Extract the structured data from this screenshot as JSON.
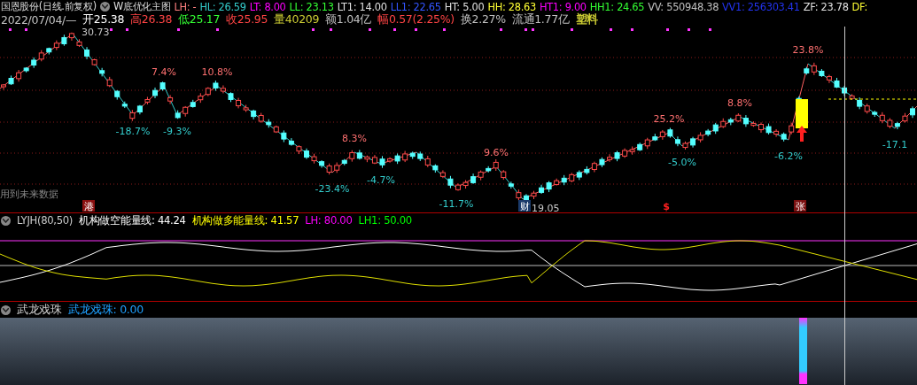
{
  "header": {
    "title": "国恩股份(日线.前复权)",
    "indicator": "W底优化主图",
    "items": [
      {
        "label": "LH: -",
        "color": "#ff8080"
      },
      {
        "label": "HL: 26.59",
        "color": "#33cccc"
      },
      {
        "label": "LT: 8.00",
        "color": "#ff00ff"
      },
      {
        "label": "LL: 23.13",
        "color": "#33ff33"
      },
      {
        "label": "LT1: 14.00",
        "color": "#e0e0e0"
      },
      {
        "label": "LL1: 22.65",
        "color": "#3355ff"
      },
      {
        "label": "HT: 5.00",
        "color": "#e0e0e0"
      },
      {
        "label": "HH: 28.63",
        "color": "#ffff33"
      },
      {
        "label": "HT1: 9.00",
        "color": "#ff00ff"
      },
      {
        "label": "HH1: 24.65",
        "color": "#33ff33"
      },
      {
        "label": "VV: 550948.38",
        "color": "#c0c0c0"
      },
      {
        "label": "VV1: 256303.41",
        "color": "#2233ee"
      },
      {
        "label": "ZF: 23.78",
        "color": "#e0e0e0"
      },
      {
        "label": "DF:",
        "color": "#ffff33"
      }
    ],
    "quote": [
      {
        "label": "2022/07/04/—",
        "color": "#c0c0c0"
      },
      {
        "label": "开25.38",
        "color": "#ffffff"
      },
      {
        "label": "高26.38",
        "color": "#ff4444"
      },
      {
        "label": "低25.17",
        "color": "#33ff33"
      },
      {
        "label": "收25.95",
        "color": "#ff4444"
      },
      {
        "label": "量40209",
        "color": "#cccc33"
      },
      {
        "label": "额1.04亿",
        "color": "#c0c0c0"
      },
      {
        "label": "幅0.57(2.25%)",
        "color": "#ff4444"
      },
      {
        "label": "换2.27%",
        "color": "#c0c0c0"
      },
      {
        "label": "流通1.77亿",
        "color": "#c0c0c0"
      },
      {
        "label": "塑料",
        "color": "#cccc33"
      }
    ]
  },
  "main_chart": {
    "warning": "用到未来数据",
    "labels": [
      {
        "text": "30.73",
        "kind": "price"
      },
      {
        "text": "-18.7%",
        "kind": "fall"
      },
      {
        "text": "7.4%",
        "kind": "rise"
      },
      {
        "text": "-9.3%",
        "kind": "fall"
      },
      {
        "text": "10.8%",
        "kind": "rise"
      },
      {
        "text": "8.3%",
        "kind": "rise"
      },
      {
        "text": "-23.4%",
        "kind": "fall"
      },
      {
        "text": "-4.7%",
        "kind": "fall"
      },
      {
        "text": "-11.7%",
        "kind": "fall"
      },
      {
        "text": "9.6%",
        "kind": "rise"
      },
      {
        "text": "19.05",
        "kind": "price"
      },
      {
        "text": "25.2%",
        "kind": "rise"
      },
      {
        "text": "-5.0%",
        "kind": "fall"
      },
      {
        "text": "8.8%",
        "kind": "rise"
      },
      {
        "text": "-6.2%",
        "kind": "fall"
      },
      {
        "text": "23.8%",
        "kind": "rise"
      },
      {
        "text": "-17.1",
        "kind": "fall"
      }
    ],
    "markers": [
      {
        "text": "港",
        "kind": "badge",
        "color": "#8b1010"
      },
      {
        "text": "财",
        "kind": "badge",
        "color": "#1a3a6a"
      },
      {
        "text": "$",
        "kind": "plain",
        "color": "#ff2020"
      },
      {
        "text": "张",
        "kind": "badge",
        "color": "#7a1010"
      }
    ]
  },
  "indicator": {
    "name": "LYJH(80,50)",
    "items": [
      {
        "label": "机构做空能量线: 44.24",
        "color": "#ffffff"
      },
      {
        "label": "机构做多能量线: 41.57",
        "color": "#ffff00"
      },
      {
        "label": "LH: 80.00",
        "color": "#ff00ff"
      },
      {
        "label": "LH1: 50.00",
        "color": "#00ff00"
      }
    ]
  },
  "bottom": {
    "name": "武龙戏珠",
    "items": [
      {
        "label": "武龙戏珠: 0.00",
        "color": "#1ea0ff"
      }
    ]
  }
}
